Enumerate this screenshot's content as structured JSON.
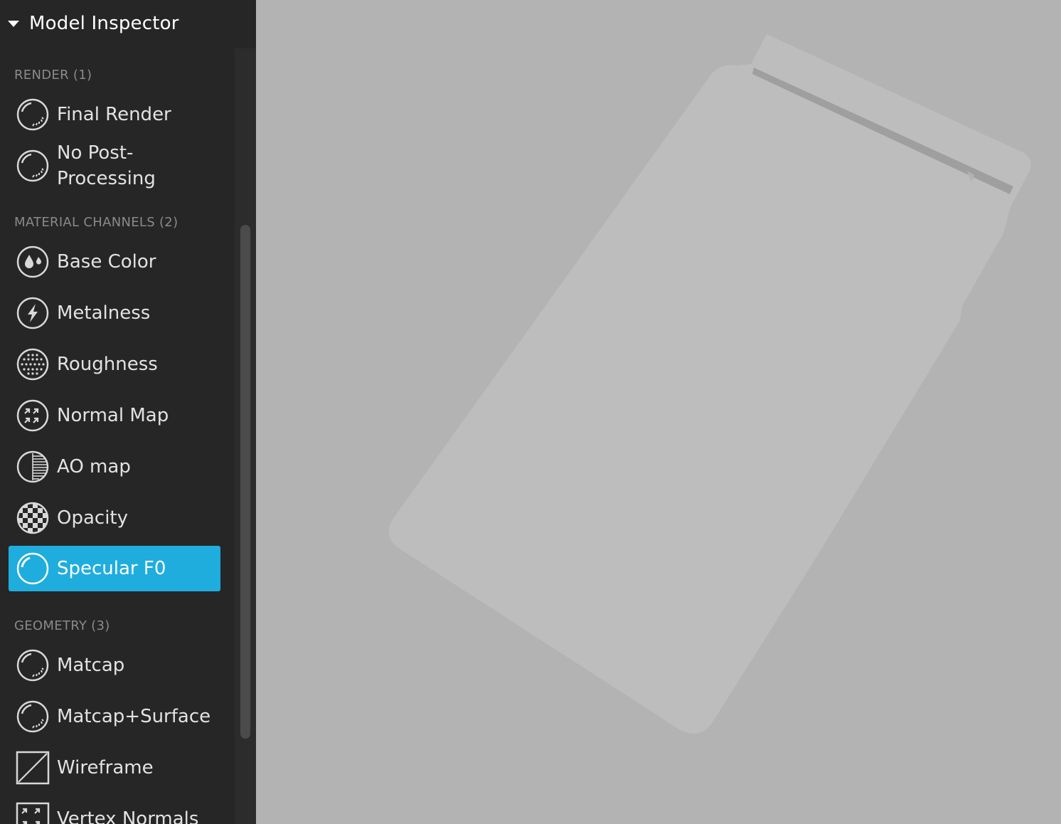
{
  "panel": {
    "title": "Model Inspector"
  },
  "sections": {
    "render": "RENDER (1)",
    "material": "MATERIAL CHANNELS (2)",
    "geometry": "GEOMETRY (3)"
  },
  "items": {
    "final_render": "Final Render",
    "no_post_line1": "No Post-",
    "no_post_line2": "Processing",
    "base_color": "Base Color",
    "metalness": "Metalness",
    "roughness": "Roughness",
    "normal_map": "Normal Map",
    "ao_map": "AO map",
    "opacity": "Opacity",
    "specular_f0": "Specular F0",
    "matcap": "Matcap",
    "matcap_surface": "Matcap+Surface",
    "wireframe": "Wireframe",
    "vertex_normals": "Vertex Normals"
  },
  "selected": "Specular F0",
  "colors": {
    "panel_bg": "#262626",
    "accent": "#1fadde",
    "viewport_bg": "#b3b3b3",
    "model": "#bdbdbd"
  }
}
